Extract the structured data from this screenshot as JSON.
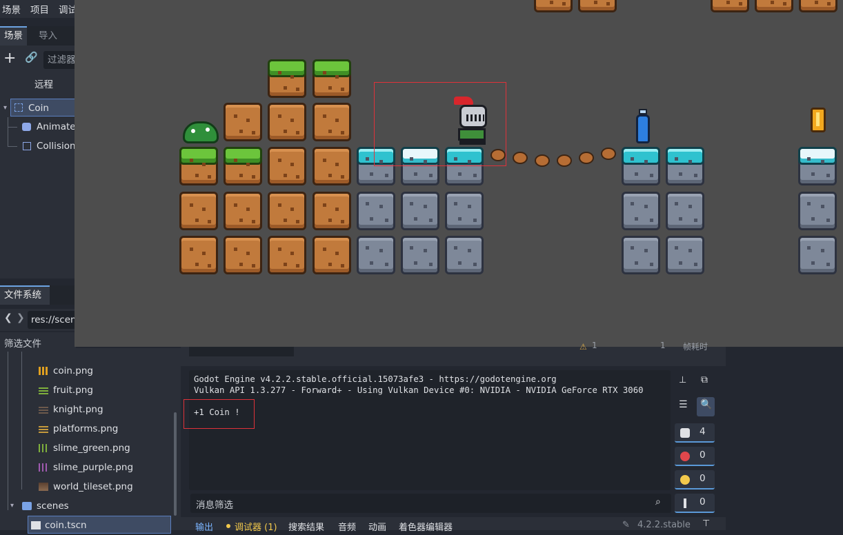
{
  "menu": [
    "场景",
    "项目",
    "调试"
  ],
  "scene_dock": {
    "tab_scene": "场景",
    "tab_import": "导入",
    "filter_placeholder": "过滤器",
    "remote": "远程",
    "tree": [
      {
        "label": "Coin",
        "icon": "area2d-icon"
      },
      {
        "label": "Animate",
        "icon": "animated-sprite-icon"
      },
      {
        "label": "Collision",
        "icon": "collision-shape-icon"
      }
    ]
  },
  "filesystem": {
    "title": "文件系统",
    "path": "res://scen",
    "filter_placeholder": "筛选文件",
    "files": [
      {
        "label": "coin.png",
        "icon": "image-icon"
      },
      {
        "label": "fruit.png",
        "icon": "image-icon"
      },
      {
        "label": "knight.png",
        "icon": "image-icon"
      },
      {
        "label": "platforms.png",
        "icon": "image-icon"
      },
      {
        "label": "slime_green.png",
        "icon": "image-icon"
      },
      {
        "label": "slime_purple.png",
        "icon": "image-icon"
      },
      {
        "label": "world_tileset.png",
        "icon": "image-icon"
      },
      {
        "label": "scenes",
        "icon": "folder-icon"
      },
      {
        "label": "coin.tscn",
        "icon": "scene-file-icon"
      }
    ]
  },
  "debugger_header": {
    "warn_count": "1",
    "frame": "1",
    "label": "帧耗时"
  },
  "output": {
    "lines": [
      "Godot Engine v4.2.2.stable.official.15073afe3 - https://godotengine.org",
      "Vulkan API 1.3.277 - Forward+ - Using Vulkan Device #0: NVIDIA - NVIDIA GeForce RTX 3060"
    ],
    "coin_message": "+1 Coin !",
    "filter_placeholder": "消息筛选"
  },
  "counters": [
    {
      "name": "messages",
      "value": "4",
      "color": "#dfe1e5"
    },
    {
      "name": "errors",
      "value": "0",
      "color": "#e0474c"
    },
    {
      "name": "warnings",
      "value": "0",
      "color": "#f2c94c"
    },
    {
      "name": "editor",
      "value": "0",
      "color": "#dfe1e5"
    }
  ],
  "bottom_tabs": [
    "输出",
    "调试器 (1)",
    "搜索结果",
    "音频",
    "动画",
    "着色器编辑器"
  ],
  "version": "4.2.2.stable",
  "colors": {
    "accent": "#6da4e3",
    "highlight_box": "#e0323a",
    "debugger_tab": "#f2c94c"
  }
}
